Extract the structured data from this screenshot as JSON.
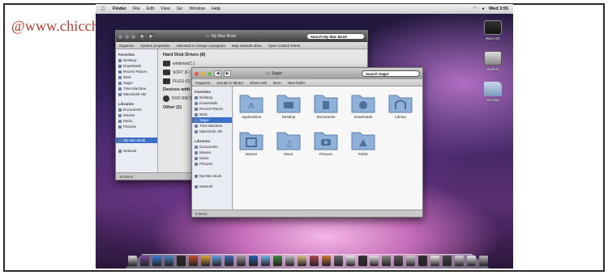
{
  "watermark": "@www.chicchedicala.it",
  "menubar": {
    "apple": "",
    "items": [
      "Finder",
      "File",
      "Edit",
      "View",
      "Go",
      "Window",
      "Help"
    ],
    "clock": "Wed 3:55"
  },
  "desktop_icons": [
    {
      "label": "iMac HD",
      "icon": "hard-drive-icon"
    },
    {
      "label": "System",
      "icon": "hard-drive-icon"
    },
    {
      "label": "Storage",
      "icon": "folder-icon"
    }
  ],
  "back_window": {
    "path": "My Mac Book",
    "search": "Search My Mac Book",
    "toolbar": [
      "Organize",
      "System properties",
      "Uninstall or change a program",
      "Map network drive",
      "Open Control Panel"
    ],
    "sidebar": {
      "favorites_header": "Favorites",
      "favorites": [
        "Desktop",
        "Downloads",
        "Recent Places",
        "iDisk",
        "Sagor",
        "Time Machine",
        "Macintosh HD"
      ],
      "libraries_header": "Libraries",
      "libraries": [
        "Documents",
        "Movies",
        "Music",
        "Pictures"
      ],
      "computer": "My Mac Book",
      "network": "Network"
    },
    "drives_header": "Hard Disk Drives (8)",
    "drives": [
      "windows(C:)",
      "SOFT (F:)",
      "FILES (G:)"
    ],
    "removable_header": "Devices with Removable Storage",
    "removable": [
      "DVD RW Drive"
    ],
    "other_header": "Other (1)",
    "status": "10 items"
  },
  "front_window": {
    "path": "Sagor",
    "search": "Search Sagor",
    "toolbar": [
      "Organize",
      "Include in library",
      "Share with",
      "Burn",
      "New folder"
    ],
    "sidebar": {
      "favorites_header": "Favorites",
      "favorites": [
        "Desktop",
        "Downloads",
        "Recent Places",
        "iDisk",
        "Sagor",
        "Time Machine",
        "Macintosh HD"
      ],
      "libraries_header": "Libraries",
      "libraries": [
        "Documents",
        "Movies",
        "Music",
        "Pictures"
      ],
      "computer": "My Mac Book",
      "network": "Network"
    },
    "folders": [
      "Applications",
      "Desktop",
      "Documents",
      "Downloads",
      "Library",
      "Movies",
      "Music",
      "Pictures",
      "Public"
    ],
    "status": "9 items"
  },
  "dock_count": 30
}
